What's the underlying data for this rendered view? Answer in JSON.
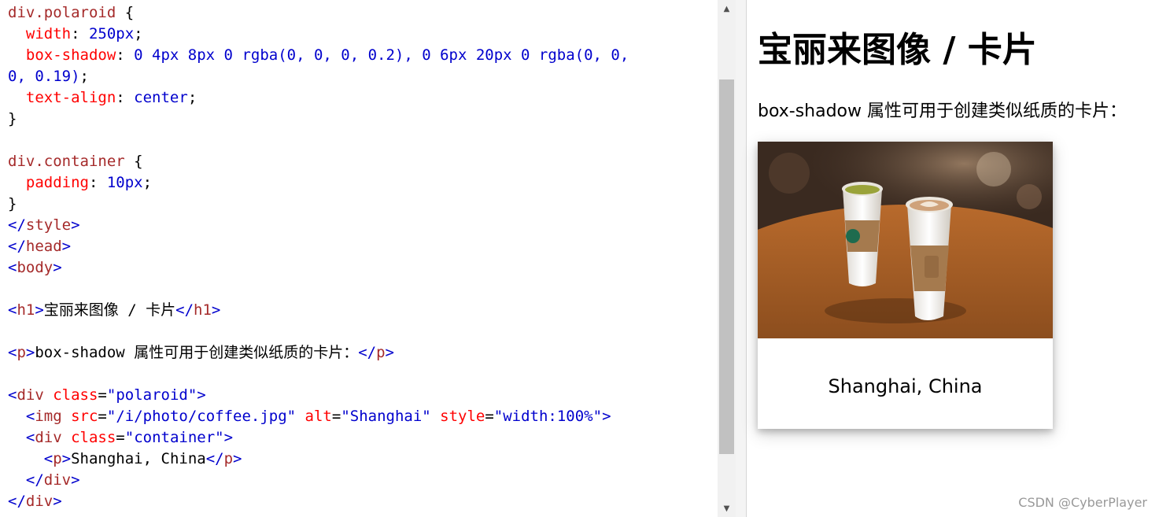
{
  "editor": {
    "lines": [
      [
        {
          "t": "div.polaroid",
          "c": "sel"
        },
        {
          "t": " {",
          "c": "txt"
        }
      ],
      [
        {
          "t": "  width",
          "c": "prop"
        },
        {
          "t": ": ",
          "c": "txt"
        },
        {
          "t": "250px",
          "c": "val"
        },
        {
          "t": ";",
          "c": "txt"
        }
      ],
      [
        {
          "t": "  box-shadow",
          "c": "prop"
        },
        {
          "t": ": ",
          "c": "txt"
        },
        {
          "t": "0 4px 8px 0 rgba(0, 0, 0, 0.2), 0 6px 20px 0 rgba(0, 0,",
          "c": "val"
        }
      ],
      [
        {
          "t": "0, 0.19)",
          "c": "val"
        },
        {
          "t": ";",
          "c": "txt"
        }
      ],
      [
        {
          "t": "  text-align",
          "c": "prop"
        },
        {
          "t": ": ",
          "c": "txt"
        },
        {
          "t": "center",
          "c": "val"
        },
        {
          "t": ";",
          "c": "txt"
        }
      ],
      [
        {
          "t": "}",
          "c": "txt"
        }
      ],
      [],
      [
        {
          "t": "div.container",
          "c": "sel"
        },
        {
          "t": " {",
          "c": "txt"
        }
      ],
      [
        {
          "t": "  padding",
          "c": "prop"
        },
        {
          "t": ": ",
          "c": "txt"
        },
        {
          "t": "10px",
          "c": "val"
        },
        {
          "t": ";",
          "c": "txt"
        }
      ],
      [
        {
          "t": "}",
          "c": "txt"
        }
      ],
      [
        {
          "t": "</",
          "c": "tag"
        },
        {
          "t": "style",
          "c": "tname"
        },
        {
          "t": ">",
          "c": "tag"
        }
      ],
      [
        {
          "t": "</",
          "c": "tag"
        },
        {
          "t": "head",
          "c": "tname"
        },
        {
          "t": ">",
          "c": "tag"
        }
      ],
      [
        {
          "t": "<",
          "c": "tag"
        },
        {
          "t": "body",
          "c": "tname"
        },
        {
          "t": ">",
          "c": "tag"
        }
      ],
      [],
      [
        {
          "t": "<",
          "c": "tag"
        },
        {
          "t": "h1",
          "c": "tname"
        },
        {
          "t": ">",
          "c": "tag"
        },
        {
          "t": "宝丽来图像 / 卡片",
          "c": "txt"
        },
        {
          "t": "</",
          "c": "tag"
        },
        {
          "t": "h1",
          "c": "tname"
        },
        {
          "t": ">",
          "c": "tag"
        }
      ],
      [],
      [
        {
          "t": "<",
          "c": "tag"
        },
        {
          "t": "p",
          "c": "tname"
        },
        {
          "t": ">",
          "c": "tag"
        },
        {
          "t": "box-shadow 属性可用于创建类似纸质的卡片：",
          "c": "txt"
        },
        {
          "t": "</",
          "c": "tag"
        },
        {
          "t": "p",
          "c": "tname"
        },
        {
          "t": ">",
          "c": "tag"
        }
      ],
      [],
      [
        {
          "t": "<",
          "c": "tag"
        },
        {
          "t": "div",
          "c": "tname"
        },
        {
          "t": " class",
          "c": "attr"
        },
        {
          "t": "=",
          "c": "txt"
        },
        {
          "t": "\"polaroid\"",
          "c": "aval"
        },
        {
          "t": ">",
          "c": "tag"
        }
      ],
      [
        {
          "t": "  <",
          "c": "tag"
        },
        {
          "t": "img",
          "c": "tname"
        },
        {
          "t": " src",
          "c": "attr"
        },
        {
          "t": "=",
          "c": "txt"
        },
        {
          "t": "\"/i/photo/coffee.jpg\"",
          "c": "aval"
        },
        {
          "t": " alt",
          "c": "attr"
        },
        {
          "t": "=",
          "c": "txt"
        },
        {
          "t": "\"Shanghai\"",
          "c": "aval"
        },
        {
          "t": " style",
          "c": "attr"
        },
        {
          "t": "=",
          "c": "txt"
        },
        {
          "t": "\"width:100%\"",
          "c": "aval"
        },
        {
          "t": ">",
          "c": "tag"
        }
      ],
      [
        {
          "t": "  <",
          "c": "tag"
        },
        {
          "t": "div",
          "c": "tname"
        },
        {
          "t": " class",
          "c": "attr"
        },
        {
          "t": "=",
          "c": "txt"
        },
        {
          "t": "\"container\"",
          "c": "aval"
        },
        {
          "t": ">",
          "c": "tag"
        }
      ],
      [
        {
          "t": "    <",
          "c": "tag"
        },
        {
          "t": "p",
          "c": "tname"
        },
        {
          "t": ">",
          "c": "tag"
        },
        {
          "t": "Shanghai, China",
          "c": "txt"
        },
        {
          "t": "</",
          "c": "tag"
        },
        {
          "t": "p",
          "c": "tname"
        },
        {
          "t": ">",
          "c": "tag"
        }
      ],
      [
        {
          "t": "  </",
          "c": "tag"
        },
        {
          "t": "div",
          "c": "tname"
        },
        {
          "t": ">",
          "c": "tag"
        }
      ],
      [
        {
          "t": "</",
          "c": "tag"
        },
        {
          "t": "div",
          "c": "tname"
        },
        {
          "t": ">",
          "c": "tag"
        }
      ]
    ]
  },
  "scrollbar": {
    "up_arrow": "▲",
    "down_arrow": "▼"
  },
  "preview": {
    "heading": "宝丽来图像 / 卡片",
    "paragraph": "box-shadow 属性可用于创建类似纸质的卡片：",
    "card": {
      "image_alt": "Shanghai",
      "caption": "Shanghai, China"
    }
  },
  "watermark": "CSDN @CyberPlayer"
}
